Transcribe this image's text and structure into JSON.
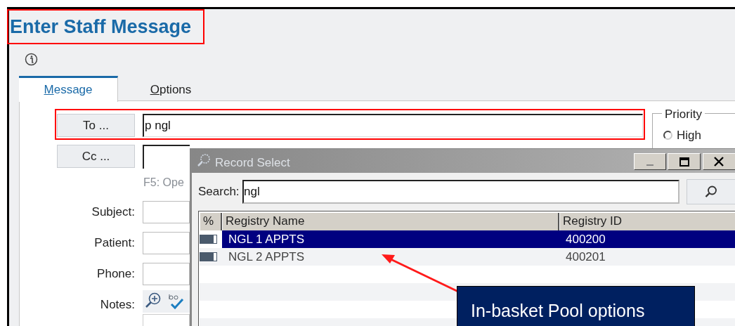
{
  "window": {
    "title": "Enter Staff Message"
  },
  "tabs": [
    {
      "label": "Message",
      "selected": true
    },
    {
      "label": "Options",
      "selected": false
    }
  ],
  "to": {
    "button": "To ...",
    "value": "p ngl"
  },
  "cc": {
    "button": "Cc ..."
  },
  "hint": "F5: Ope",
  "fields": [
    {
      "label": "Subject:"
    },
    {
      "label": "Patient:"
    },
    {
      "label": "Phone:"
    }
  ],
  "notes": {
    "label": "Notes:"
  },
  "priority": {
    "legend": "Priority",
    "options": [
      {
        "label": "High",
        "selected": false
      }
    ]
  },
  "dialog": {
    "title": "Record Select",
    "search_label": "Search:",
    "search_value": "ngl",
    "columns": [
      "%",
      "Registry Name",
      "Registry ID"
    ],
    "rows": [
      {
        "name": "NGL 1 APPTS",
        "id": "400200",
        "selected": true
      },
      {
        "name": "NGL 2 APPTS",
        "id": "400201",
        "selected": false
      }
    ]
  },
  "callout": {
    "text": "In-basket Pool options"
  }
}
